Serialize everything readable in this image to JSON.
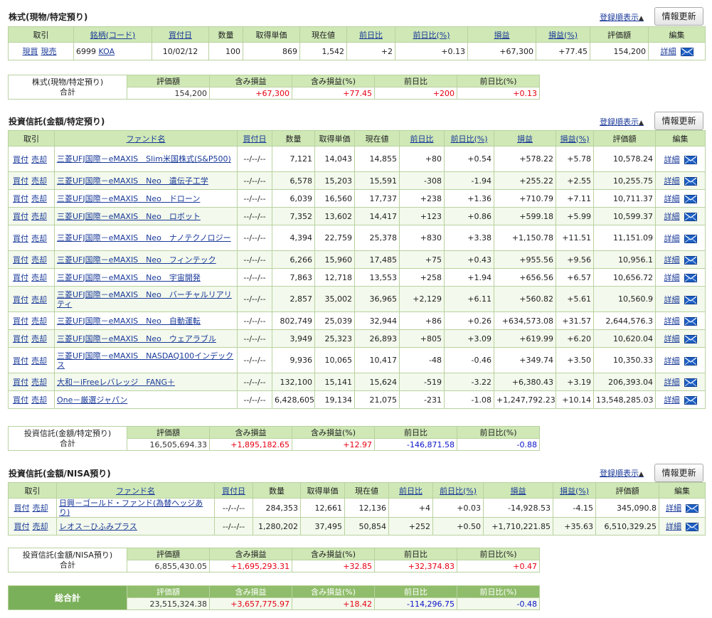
{
  "common": {
    "sort_link": "登録順表示",
    "sort_tri": "▲",
    "refresh": "情報更新",
    "detail": "詳細",
    "buy": "買付",
    "sell": "売却"
  },
  "stock": {
    "title": "株式(現物/特定預り)",
    "headers": [
      "取引",
      "銘柄(コード)",
      "買付日",
      "数量",
      "取得単価",
      "現在値",
      "前日比",
      "前日比(%)",
      "損益",
      "損益(%)",
      "評価額",
      "編集"
    ],
    "rows": [
      {
        "act1": "現買",
        "act2": "現売",
        "code": "6999",
        "name": "KOA",
        "date": "10/02/12",
        "qty": "100",
        "cost": "869",
        "price": "1,542",
        "chg": "+2",
        "chgpct": "+0.13",
        "pl": "+67,300",
        "plpct": "+77.45",
        "value": "154,200"
      }
    ],
    "summary": {
      "label1": "株式(現物/特定預り)",
      "label2": "合計",
      "headers": [
        "評価額",
        "含み損益",
        "含み損益(%)",
        "前日比",
        "前日比(%)"
      ],
      "values": [
        "154,200",
        "+67,300",
        "+77.45",
        "+200",
        "+0.13"
      ]
    }
  },
  "fund_tokutei": {
    "title": "投資信託(金額/特定預り)",
    "headers": [
      "取引",
      "ファンド名",
      "買付日",
      "数量",
      "取得単価",
      "現在値",
      "前日比",
      "前日比(%)",
      "損益",
      "損益(%)",
      "評価額",
      "編集"
    ],
    "rows": [
      {
        "name": "三菱UFJ国際－eMAXIS　Slim米国株式(S&P500)",
        "date": "--/--/--",
        "qty": "7,121",
        "cost": "14,043",
        "price": "14,855",
        "chg": "+80",
        "chgpct": "+0.54",
        "pl": "+578.22",
        "plpct": "+5.78",
        "value": "10,578.24"
      },
      {
        "name": "三菱UFJ国際－eMAXIS　Neo　遺伝子工学",
        "date": "--/--/--",
        "qty": "6,578",
        "cost": "15,203",
        "price": "15,591",
        "chg": "-308",
        "chgpct": "-1.94",
        "pl": "+255.22",
        "plpct": "+2.55",
        "value": "10,255.75"
      },
      {
        "name": "三菱UFJ国際－eMAXIS　Neo　ドローン",
        "date": "--/--/--",
        "qty": "6,039",
        "cost": "16,560",
        "price": "17,737",
        "chg": "+238",
        "chgpct": "+1.36",
        "pl": "+710.79",
        "plpct": "+7.11",
        "value": "10,711.37"
      },
      {
        "name": "三菱UFJ国際－eMAXIS　Neo　ロボット",
        "date": "--/--/--",
        "qty": "7,352",
        "cost": "13,602",
        "price": "14,417",
        "chg": "+123",
        "chgpct": "+0.86",
        "pl": "+599.18",
        "plpct": "+5.99",
        "value": "10,599.37"
      },
      {
        "name": "三菱UFJ国際－eMAXIS　Neo　ナノテクノロジー",
        "date": "--/--/--",
        "qty": "4,394",
        "cost": "22,759",
        "price": "25,378",
        "chg": "+830",
        "chgpct": "+3.38",
        "pl": "+1,150.78",
        "plpct": "+11.51",
        "value": "11,151.09"
      },
      {
        "name": "三菱UFJ国際－eMAXIS　Neo　フィンテック",
        "date": "--/--/--",
        "qty": "6,266",
        "cost": "15,960",
        "price": "17,485",
        "chg": "+75",
        "chgpct": "+0.43",
        "pl": "+955.56",
        "plpct": "+9.56",
        "value": "10,956.1"
      },
      {
        "name": "三菱UFJ国際－eMAXIS　Neo　宇宙開発",
        "date": "--/--/--",
        "qty": "7,863",
        "cost": "12,718",
        "price": "13,553",
        "chg": "+258",
        "chgpct": "+1.94",
        "pl": "+656.56",
        "plpct": "+6.57",
        "value": "10,656.72"
      },
      {
        "name": "三菱UFJ国際－eMAXIS　Neo　バーチャルリアリティ",
        "date": "--/--/--",
        "qty": "2,857",
        "cost": "35,002",
        "price": "36,965",
        "chg": "+2,129",
        "chgpct": "+6.11",
        "pl": "+560.82",
        "plpct": "+5.61",
        "value": "10,560.9"
      },
      {
        "name": "三菱UFJ国際－eMAXIS　Neo　自動運転",
        "date": "--/--/--",
        "qty": "802,749",
        "cost": "25,039",
        "price": "32,944",
        "chg": "+86",
        "chgpct": "+0.26",
        "pl": "+634,573.08",
        "plpct": "+31.57",
        "value": "2,644,576.3"
      },
      {
        "name": "三菱UFJ国際－eMAXIS　Neo　ウェアラブル",
        "date": "--/--/--",
        "qty": "3,949",
        "cost": "25,323",
        "price": "26,893",
        "chg": "+805",
        "chgpct": "+3.09",
        "pl": "+619.99",
        "plpct": "+6.20",
        "value": "10,620.04"
      },
      {
        "name": "三菱UFJ国際－eMAXIS　NASDAQ100インデックス",
        "date": "--/--/--",
        "qty": "9,936",
        "cost": "10,065",
        "price": "10,417",
        "chg": "-48",
        "chgpct": "-0.46",
        "pl": "+349.74",
        "plpct": "+3.50",
        "value": "10,350.33"
      },
      {
        "name": "大和－iFreeレバレッジ　FANG＋",
        "date": "--/--/--",
        "qty": "132,100",
        "cost": "15,141",
        "price": "15,624",
        "chg": "-519",
        "chgpct": "-3.22",
        "pl": "+6,380.43",
        "plpct": "+3.19",
        "value": "206,393.04"
      },
      {
        "name": "One－厳選ジャパン",
        "date": "--/--/--",
        "qty": "6,428,605",
        "cost": "19,134",
        "price": "21,075",
        "chg": "-231",
        "chgpct": "-1.08",
        "pl": "+1,247,792.23",
        "plpct": "+10.14",
        "value": "13,548,285.03"
      }
    ],
    "summary": {
      "label1": "投資信託(金額/特定預り)",
      "label2": "合計",
      "headers": [
        "評価額",
        "含み損益",
        "含み損益(%)",
        "前日比",
        "前日比(%)"
      ],
      "values": [
        "16,505,694.33",
        "+1,895,182.65",
        "+12.97",
        "-146,871.58",
        "-0.88"
      ]
    }
  },
  "fund_nisa": {
    "title": "投資信託(金額/NISA預り)",
    "headers": [
      "取引",
      "ファンド名",
      "買付日",
      "数量",
      "取得単価",
      "現在値",
      "前日比",
      "前日比(%)",
      "損益",
      "損益(%)",
      "評価額",
      "編集"
    ],
    "rows": [
      {
        "name": "日興－ゴールド・ファンド(為替ヘッジあり)",
        "date": "--/--/--",
        "qty": "284,353",
        "cost": "12,661",
        "price": "12,136",
        "chg": "+4",
        "chgpct": "+0.03",
        "pl": "-14,928.53",
        "plpct": "-4.15",
        "value": "345,090.8"
      },
      {
        "name": "レオス－ひふみプラス",
        "date": "--/--/--",
        "qty": "1,280,202",
        "cost": "37,495",
        "price": "50,854",
        "chg": "+252",
        "chgpct": "+0.50",
        "pl": "+1,710,221.85",
        "plpct": "+35.63",
        "value": "6,510,329.25"
      }
    ],
    "summary": {
      "label1": "投資信託(金額/NISA預り)",
      "label2": "合計",
      "headers": [
        "評価額",
        "含み損益",
        "含み損益(%)",
        "前日比",
        "前日比(%)"
      ],
      "values": [
        "6,855,430.05",
        "+1,695,293.31",
        "+32.85",
        "+32,374.83",
        "+0.47"
      ]
    }
  },
  "grand_total": {
    "label": "総合計",
    "headers": [
      "評価額",
      "含み損益",
      "含み損益(%)",
      "前日比",
      "前日比(%)"
    ],
    "values": [
      "23,515,324.38",
      "+3,657,775.97",
      "+18.42",
      "-114,296.75",
      "-0.48"
    ]
  },
  "colors": {
    "positive": "#e60012",
    "negative": "#0a14c8",
    "header_bg": "#cfe8b6",
    "total_bg": "#7bb05a",
    "link": "#1a3a99"
  }
}
